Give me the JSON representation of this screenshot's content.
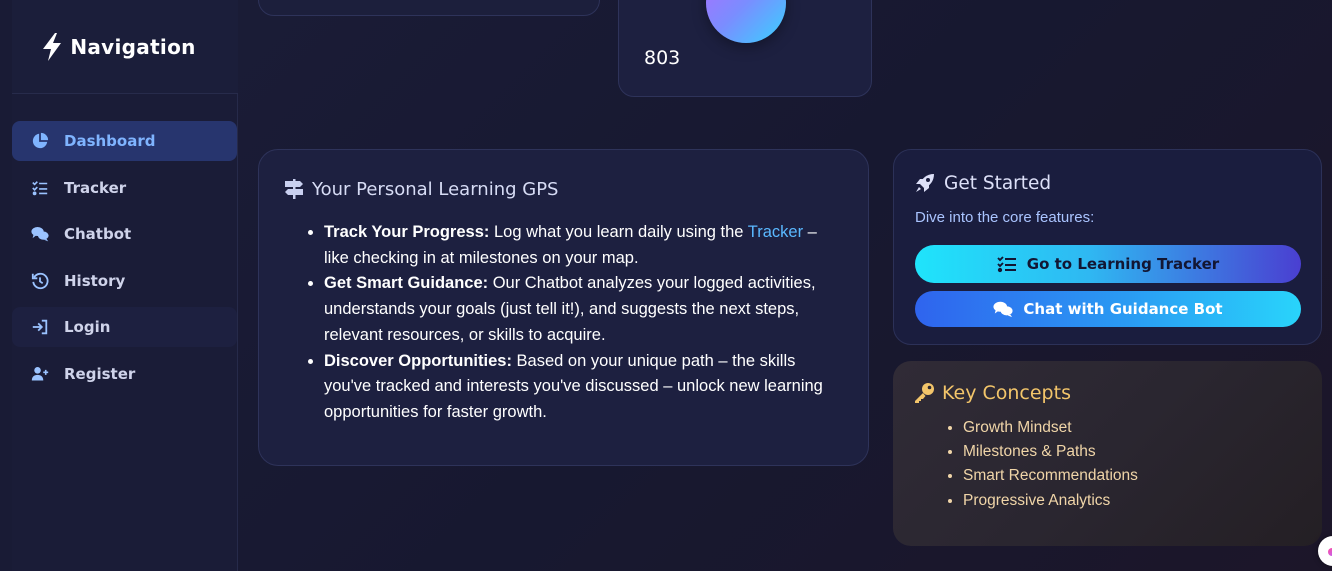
{
  "sidebar": {
    "title": "Navigation",
    "items": [
      {
        "label": "Dashboard",
        "icon": "pie-chart-icon",
        "active": true
      },
      {
        "label": "Tracker",
        "icon": "checklist-icon",
        "active": false
      },
      {
        "label": "Chatbot",
        "icon": "chat-bubbles-icon",
        "active": false
      },
      {
        "label": "History",
        "icon": "history-icon",
        "active": false
      },
      {
        "label": "Login",
        "icon": "login-icon",
        "active": false
      },
      {
        "label": "Register",
        "icon": "user-plus-icon",
        "active": false
      }
    ]
  },
  "stat_card": {
    "value": "803"
  },
  "gps_card": {
    "title": "Your Personal Learning GPS",
    "items": [
      {
        "heading": "Track Your Progress:",
        "text_before": " Log what you learn daily using the ",
        "link": "Tracker",
        "text_after": " – like checking in at milestones on your map."
      },
      {
        "heading": "Get Smart Guidance:",
        "text": " Our Chatbot analyzes your logged activities, understands your goals (just tell it!), and suggests the next steps, relevant resources, or skills to acquire."
      },
      {
        "heading": "Discover Opportunities:",
        "text": " Based on your unique path – the skills you've tracked and interests you've discussed – unlock new learning opportunities for faster growth."
      }
    ]
  },
  "get_started": {
    "title": "Get Started",
    "subtitle": "Dive into the core features:",
    "tracker_button": "Go to Learning Tracker",
    "chat_button": "Chat with Guidance Bot"
  },
  "key_concepts": {
    "title": "Key Concepts",
    "items": [
      "Growth Mindset",
      "Milestones & Paths",
      "Smart Recommendations",
      "Progressive Analytics"
    ]
  },
  "colors": {
    "background": "#1b1d38",
    "active_nav": "#27356e",
    "accent_link": "#5ab8ff",
    "key_concepts_title": "#f3c56a"
  }
}
